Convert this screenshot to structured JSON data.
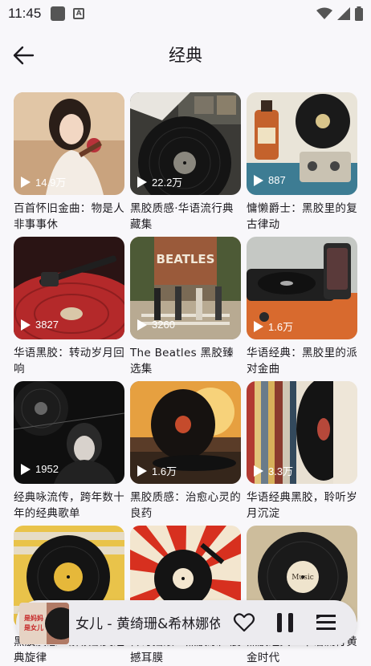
{
  "status": {
    "time": "11:45",
    "icons": [
      "square-icon",
      "text-a-icon",
      "wifi-icon",
      "cellular-icon",
      "battery-icon"
    ]
  },
  "header": {
    "title": "经典",
    "back_icon": "arrow-left-icon"
  },
  "playlists": [
    {
      "plays": "14.9万",
      "title": "百首怀旧金曲：物是人非事事休"
    },
    {
      "plays": "22.2万",
      "title": "黑胶质感·华语流行典藏集"
    },
    {
      "plays": "887",
      "title": "慵懒爵士：黑胶里的复古律动"
    },
    {
      "plays": "3827",
      "title": "华语黑胶：转动岁月回响"
    },
    {
      "plays": "3260",
      "title": "The Beatles 黑胶臻选集",
      "cover_text": "BEATLES"
    },
    {
      "plays": "1.6万",
      "title": "华语经典：黑胶里的派对金曲"
    },
    {
      "plays": "1952",
      "title": "经典咏流传，跨年数十年的经典歌单"
    },
    {
      "plays": "1.6万",
      "title": "黑胶质感：治愈心灵的良药"
    },
    {
      "plays": "3.3万",
      "title": "华语经典黑胶，聆听岁月沉淀"
    },
    {
      "plays": "",
      "title": "黑胶质感：解锁欧美经典旋律"
    },
    {
      "plays": "",
      "title": "传奇摇滚：黑胶原声震撼耳膜"
    },
    {
      "plays": "",
      "title": "黑胶经典：华语流行黄金时代",
      "cover_text": "Music"
    }
  ],
  "player": {
    "title": "女儿 - 黄绮珊&希林娜依",
    "art_text": "是妈妈 是女儿",
    "icons": [
      "heart-icon",
      "pause-icon",
      "playlist-icon"
    ]
  }
}
